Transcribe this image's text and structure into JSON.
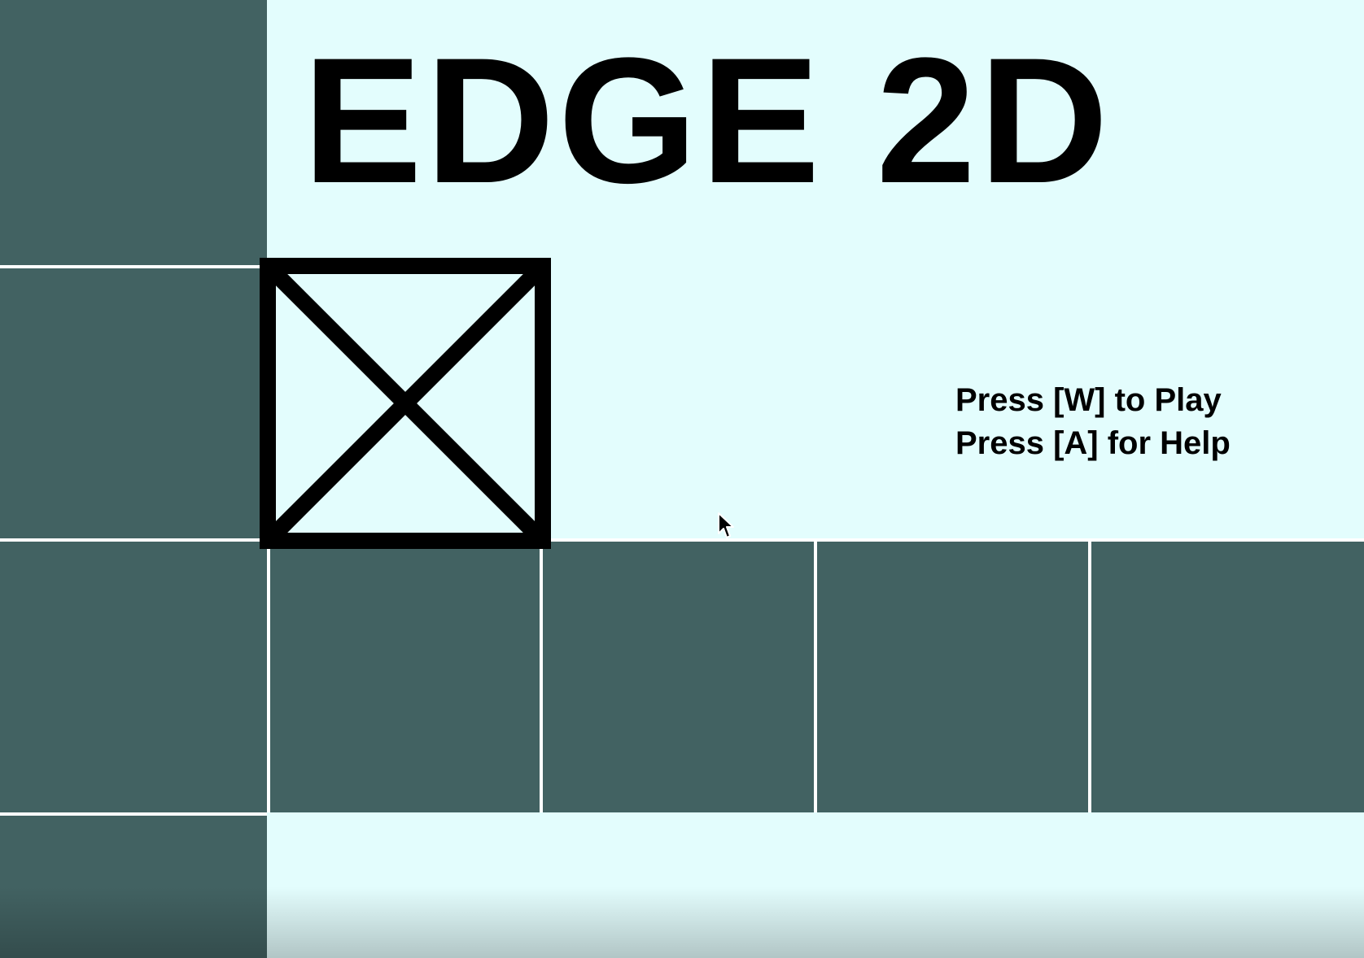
{
  "game": {
    "title": "EDGE 2D",
    "prompts": {
      "play": "Press [W] to Play",
      "help": "Press [A] for Help"
    }
  },
  "colors": {
    "background": "#E3FDFD",
    "tile": "#426262",
    "grid_line": "#FFFFFF",
    "text": "#000000",
    "player_outline": "#000000"
  },
  "icons": {
    "player": "crossed-square-icon",
    "cursor": "mouse-pointer-icon"
  }
}
